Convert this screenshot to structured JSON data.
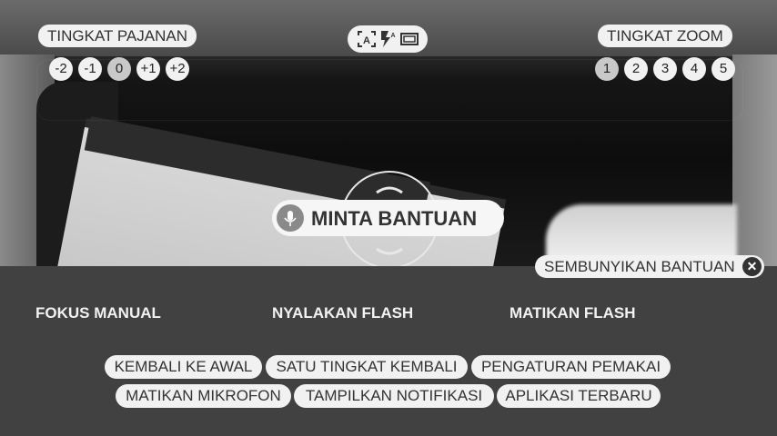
{
  "viewfinder": {
    "exposure_label": "TINGKAT PAJANAN",
    "exposure_levels": [
      "-2",
      "-1",
      "0",
      "+1",
      "+2"
    ],
    "exposure_selected": "0",
    "zoom_label": "TINGKAT ZOOM",
    "zoom_levels": [
      "1",
      "2",
      "3",
      "4",
      "5"
    ],
    "zoom_selected": "1",
    "mode_icons": [
      "auto-focus-icon",
      "flash-auto-icon",
      "aspect-ratio-icon"
    ]
  },
  "help": {
    "label": "MINTA BANTUAN",
    "hide_label": "SEMBUNYIKAN BANTUAN"
  },
  "commands": {
    "focus": "FOKUS MANUAL",
    "flash_on": "NYALAKAN FLASH",
    "flash_off": "MATIKAN FLASH"
  },
  "shortcuts": {
    "row1": [
      "KEMBALI KE AWAL",
      "SATU TINGKAT KEMBALI",
      "PENGATURAN PEMAKAI"
    ],
    "row2": [
      "MATIKAN MIKROFON",
      "TAMPILKAN NOTIFIKASI",
      "APLIKASI TERBARU"
    ]
  }
}
